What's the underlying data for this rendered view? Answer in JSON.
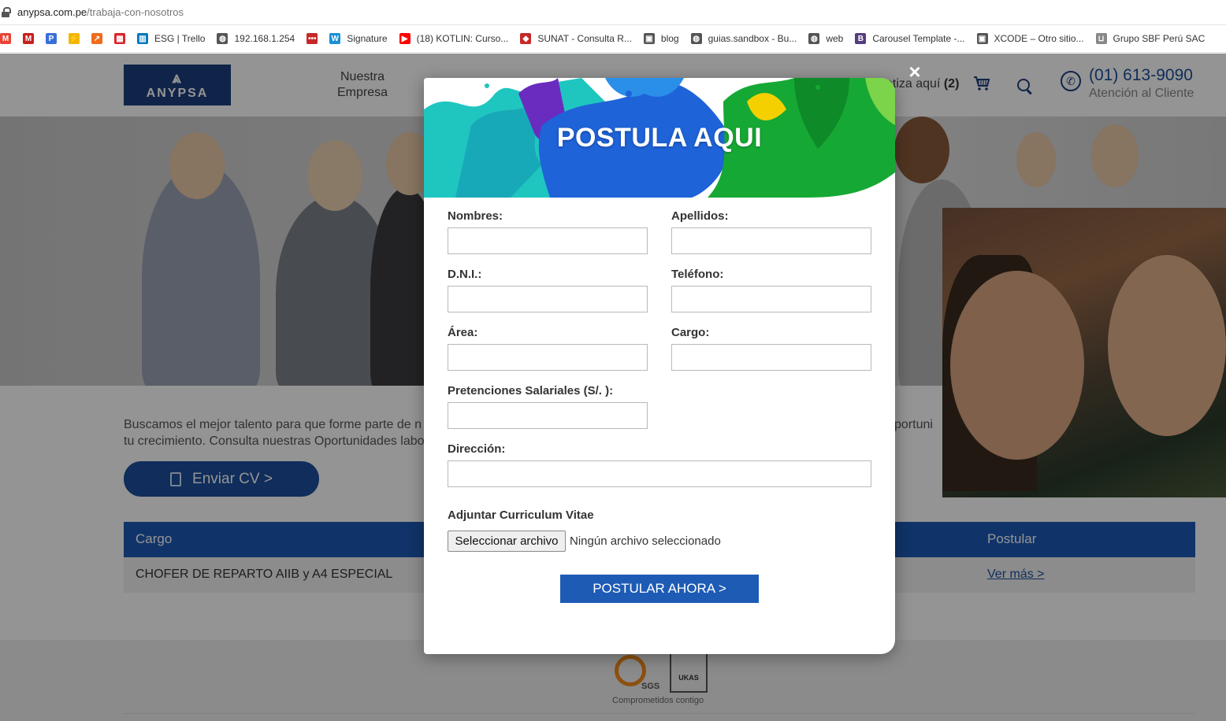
{
  "browser": {
    "url_host": "anypsa.com.pe",
    "url_path": "/trabaja-con-nosotros",
    "bookmarks": [
      {
        "label": "",
        "icon": "gmail-icon",
        "color": "#ea4335"
      },
      {
        "label": "",
        "icon": "gmail-m-icon",
        "color": "#c5221f"
      },
      {
        "label": "",
        "icon": "p-icon",
        "color": "#3a6fd8"
      },
      {
        "label": "",
        "icon": "lightning-icon",
        "color": "#f2b705"
      },
      {
        "label": "",
        "icon": "arrow-icon",
        "color": "#f26b1d"
      },
      {
        "label": "",
        "icon": "grid-icon",
        "color": "#d9262c"
      },
      {
        "label": "ESG | Trello",
        "icon": "trello-icon",
        "color": "#0079bf"
      },
      {
        "label": "192.168.1.254",
        "icon": "globe-icon",
        "color": "#555555"
      },
      {
        "label": "",
        "icon": "dots-icon",
        "color": "#c62828"
      },
      {
        "label": "Signature",
        "icon": "signature-icon",
        "color": "#1a8fd6"
      },
      {
        "label": "(18) KOTLIN: Curso...",
        "icon": "youtube-icon",
        "color": "#ff0000"
      },
      {
        "label": "SUNAT - Consulta R...",
        "icon": "sunat-icon",
        "color": "#c62828"
      },
      {
        "label": "blog",
        "icon": "blog-icon",
        "color": "#555555"
      },
      {
        "label": "guias.sandbox - Bu...",
        "icon": "globe-icon",
        "color": "#555555"
      },
      {
        "label": "web",
        "icon": "globe-icon",
        "color": "#555555"
      },
      {
        "label": "Carousel Template -...",
        "icon": "bootstrap-icon",
        "color": "#563d7c"
      },
      {
        "label": "XCODE – Otro sitio...",
        "icon": "xcode-icon",
        "color": "#555555"
      },
      {
        "label": "Grupo SBF Perú SAC",
        "icon": "cart-icon",
        "color": "#888888"
      }
    ]
  },
  "header": {
    "logo_text": "ANYPSA",
    "nav_item": "Nuestra Empresa",
    "nav_line1": "Nuestra",
    "nav_line2": "Empresa",
    "cotiza_text": "otiza aquí",
    "cotiza_count": "(2)",
    "phone": "(01) 613-9090",
    "phone_sub": "Atención al Cliente"
  },
  "page": {
    "intro_left": "Buscamos el mejor talento para que forme parte de n",
    "intro_left2": "tu crecimiento. Consulta nuestras Oportunidades labo",
    "intro_right": "portuni",
    "cv_button": "Enviar CV >",
    "table": {
      "col_cargo": "Cargo",
      "col_postular": "Postular",
      "rows": [
        {
          "cargo": "CHOFER DE REPARTO AIIB y A4 ESPECIAL",
          "postular": "Ver más >"
        }
      ]
    },
    "footer_caption": "Comprometidos contigo",
    "cert_sgs": "SGS",
    "cert_ukas": "UKAS"
  },
  "modal": {
    "title": "POSTULA AQUI",
    "close": "×",
    "fields": {
      "nombres": {
        "label": "Nombres:",
        "value": ""
      },
      "apellidos": {
        "label": "Apellidos:",
        "value": ""
      },
      "dni": {
        "label": "D.N.I.:",
        "value": ""
      },
      "telefono": {
        "label": "Teléfono:",
        "value": ""
      },
      "area": {
        "label": "Área:",
        "value": ""
      },
      "cargo": {
        "label": "Cargo:",
        "value": ""
      },
      "salario": {
        "label": "Pretenciones Salariales (S/. ):",
        "value": ""
      },
      "direccion": {
        "label": "Dirección:",
        "value": ""
      }
    },
    "attach_label": "Adjuntar Curriculum Vitae",
    "file_button": "Seleccionar archivo",
    "file_status": "Ningún archivo seleccionado",
    "submit": "POSTULAR AHORA >",
    "colors": {
      "accent": "#1d5bb5",
      "splash_teal": "#1fc6c0",
      "splash_blue": "#1e63d8",
      "splash_green": "#16a834",
      "splash_purple": "#6a2bbf"
    }
  }
}
